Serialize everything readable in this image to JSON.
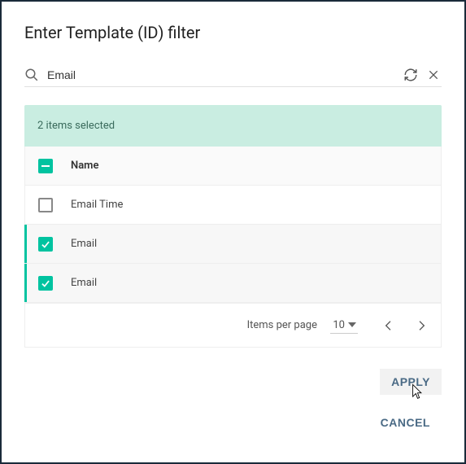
{
  "dialog": {
    "title": "Enter Template (ID) filter"
  },
  "search": {
    "value": "Email"
  },
  "selection": {
    "summary": "2 items selected"
  },
  "table": {
    "header": {
      "name": "Name"
    },
    "rows": [
      {
        "label": "Email Time",
        "checked": false
      },
      {
        "label": "Email",
        "checked": true
      },
      {
        "label": "Email",
        "checked": true
      }
    ]
  },
  "pager": {
    "label": "Items per page",
    "value": "10"
  },
  "actions": {
    "apply": "APPLY",
    "cancel": "CANCEL"
  }
}
